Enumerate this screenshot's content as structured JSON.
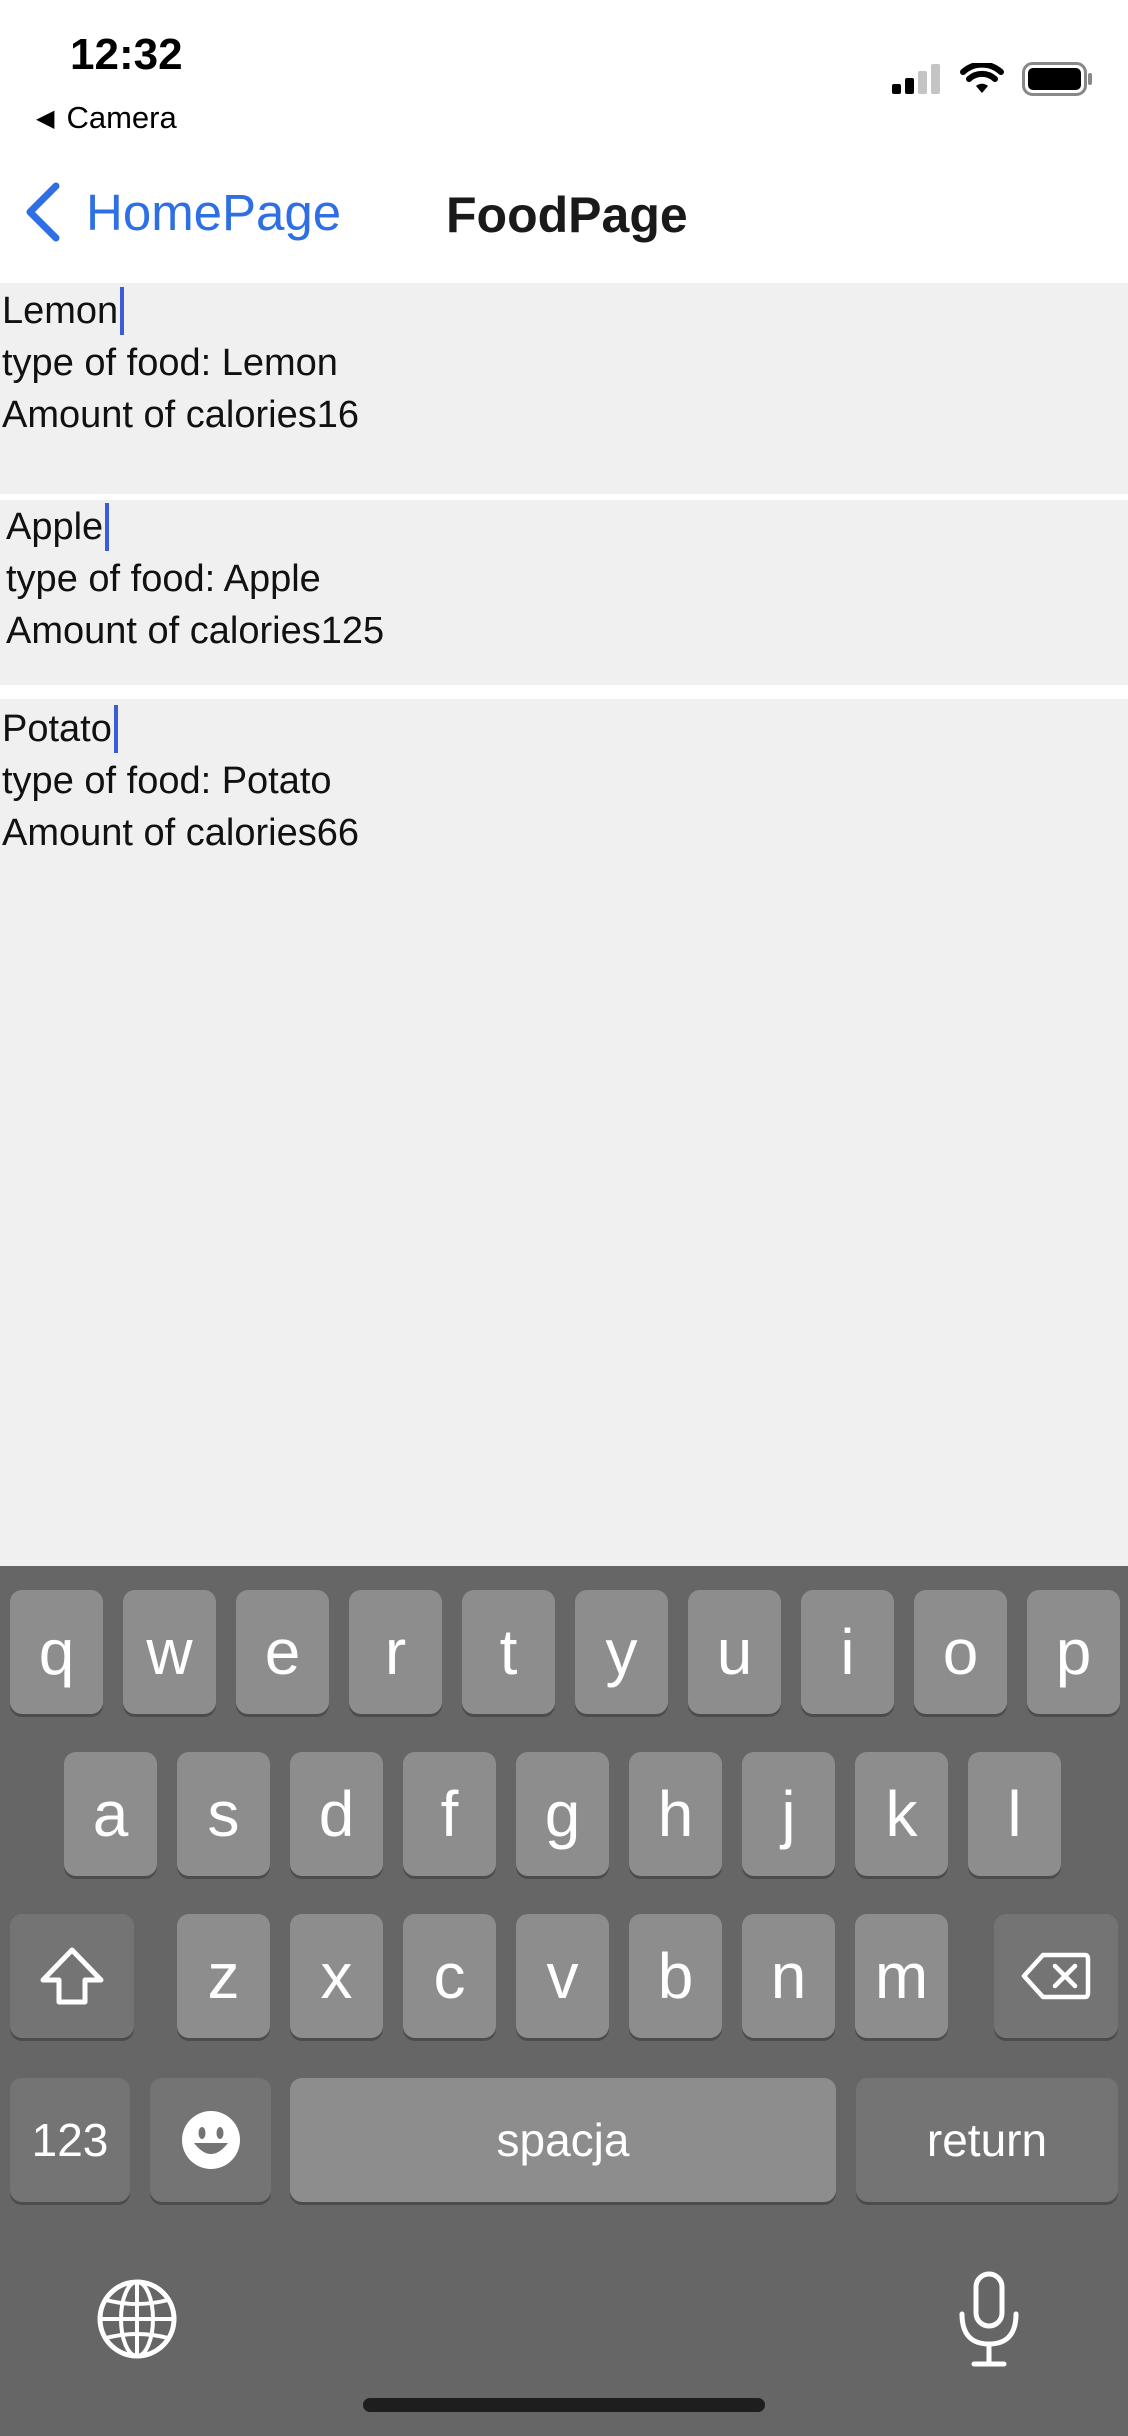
{
  "status_bar": {
    "time": "12:32",
    "back_app": "Camera"
  },
  "nav": {
    "back_label": "HomePage",
    "title": "FoodPage"
  },
  "foods": [
    {
      "name": "Lemon",
      "type_line": "type of food: Lemon",
      "calories_line": "Amount of calories16"
    },
    {
      "name": "Apple",
      "type_line": "type of food: Apple",
      "calories_line": "Amount of calories125"
    },
    {
      "name": "Potato",
      "type_line": "type of food: Potato",
      "calories_line": "Amount of calories66"
    }
  ],
  "keyboard": {
    "row1": [
      "q",
      "w",
      "e",
      "r",
      "t",
      "y",
      "u",
      "i",
      "o",
      "p"
    ],
    "row2": [
      "a",
      "s",
      "d",
      "f",
      "g",
      "h",
      "j",
      "k",
      "l"
    ],
    "row3": [
      "z",
      "x",
      "c",
      "v",
      "b",
      "n",
      "m"
    ],
    "numbers_label": "123",
    "space_label": "spacja",
    "return_label": "return"
  },
  "colors": {
    "accent": "#2f6fe4",
    "cursor": "#3b5bdb",
    "content_bg": "#f0f0f0",
    "keyboard_bg": "#666666",
    "key_bg": "#8d8d8d"
  },
  "icons": [
    "signal-icon",
    "wifi-icon",
    "battery-icon",
    "chevron-left-icon",
    "shift-icon",
    "backspace-icon",
    "emoji-icon",
    "globe-icon",
    "microphone-icon"
  ]
}
